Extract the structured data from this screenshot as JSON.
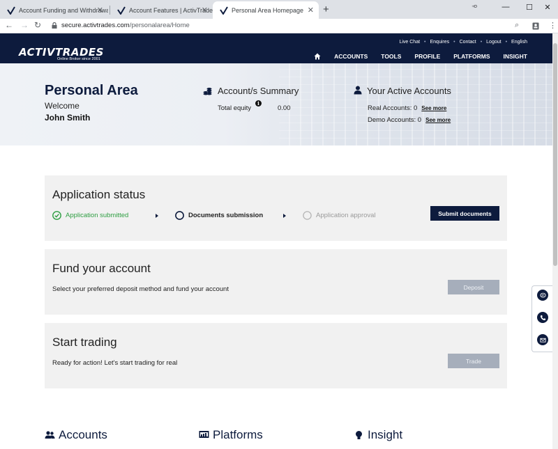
{
  "browser": {
    "tabs": [
      {
        "title": "Account Funding and Withdrawals",
        "active": false
      },
      {
        "title": "Account Features | ActivTrades",
        "active": false
      },
      {
        "title": "Personal Area Homepage",
        "active": true
      }
    ],
    "new_tab": "+",
    "url_host": "secure.activtrades.com",
    "url_path": "/personalarea/Home"
  },
  "header": {
    "logo_text": "ACTIVTRADES",
    "logo_subtitle": "Online Broker since 2001",
    "top_links": [
      "Live Chat",
      "Enquires",
      "Contact",
      "Logout",
      "English"
    ],
    "nav": [
      "ACCOUNTS",
      "TOOLS",
      "PROFILE",
      "PLATFORMS",
      "INSIGHT"
    ]
  },
  "hero": {
    "title": "Personal Area",
    "welcome": "Welcome",
    "user_name": "John Smith",
    "summary": {
      "title": "Account/s Summary",
      "equity_label": "Total equity",
      "equity_value": "0.00"
    },
    "active_accounts": {
      "title": "Your Active Accounts",
      "real_label": "Real Accounts: 0",
      "demo_label": "Demo Accounts: 0",
      "see_more": "See more"
    }
  },
  "application": {
    "title": "Application status",
    "steps": [
      {
        "label": "Application submitted",
        "state": "done"
      },
      {
        "label": "Documents submission",
        "state": "current"
      },
      {
        "label": "Application approval",
        "state": "pending"
      }
    ],
    "button": "Submit documents"
  },
  "fund": {
    "title": "Fund your account",
    "desc": "Select your preferred deposit method and fund your account",
    "button": "Deposit"
  },
  "trade": {
    "title": "Start trading",
    "desc": "Ready for action! Let's start trading for real",
    "button": "Trade"
  },
  "sections": [
    "Accounts",
    "Platforms",
    "Insight"
  ],
  "colors": {
    "navy": "#0d1b3d",
    "success": "#2e9e42",
    "card_bg": "#f1f1f1",
    "disabled_button": "#a6aebb"
  }
}
